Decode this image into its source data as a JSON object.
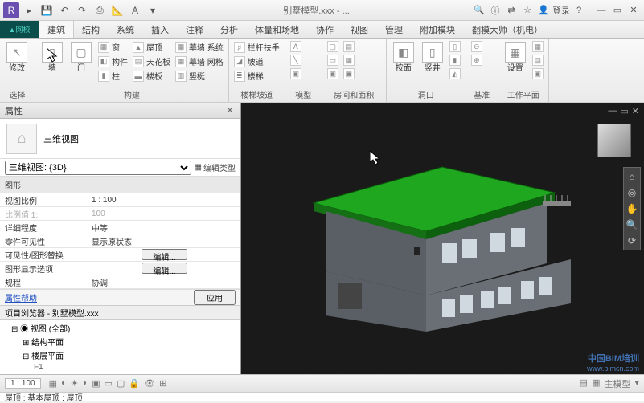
{
  "titlebar": {
    "doc_title": "别墅模型.xxx - ...",
    "login": "登录"
  },
  "ribbon_tabs": [
    "建筑",
    "结构",
    "系统",
    "插入",
    "注释",
    "分析",
    "体量和场地",
    "协作",
    "视图",
    "管理",
    "附加模块",
    "翻模大师（机电）"
  ],
  "active_tab": "建筑",
  "ribbon": {
    "select": {
      "label": "选择",
      "modify": "修改"
    },
    "build": {
      "label": "构建",
      "wall": "墙",
      "door": "门",
      "component": "构件",
      "column": "柱",
      "window": "窗",
      "roof": "屋顶",
      "ceiling": "天花板",
      "floor": "楼板",
      "curtain_system": "幕墙 系统",
      "curtain_grid": "幕墙 网格",
      "mullion": "竖梃"
    },
    "stair_ramp": {
      "label": "楼梯坡道",
      "railing": "栏杆扶手",
      "ramp": "坡道",
      "stair": "楼梯"
    },
    "model": {
      "label": "模型"
    },
    "room_area": {
      "label": "房间和面积"
    },
    "opening": {
      "label": "洞口",
      "by_face": "按面",
      "dormer": "竖井"
    },
    "datum": {
      "label": "基准"
    },
    "work_plane": {
      "label": "工作平面",
      "set": "设置"
    }
  },
  "props": {
    "title": "属性",
    "view_type": "三维视图",
    "selector": "三维视图: {3D}",
    "edit_type": "编辑类型",
    "group_graphics": "图形",
    "rows": [
      {
        "k": "视图比例",
        "v": "1 : 100"
      },
      {
        "k": "比例值 1:",
        "v": "100",
        "disabled": true
      },
      {
        "k": "详细程度",
        "v": "中等"
      },
      {
        "k": "零件可见性",
        "v": "显示原状态"
      },
      {
        "k": "可见性/图形替换",
        "btn": "编辑..."
      },
      {
        "k": "图形显示选项",
        "btn": "编辑..."
      },
      {
        "k": "规程",
        "v": "协调"
      }
    ],
    "help": "属性帮助",
    "apply": "应用"
  },
  "browser": {
    "title": "项目浏览器 - 别墅模型.xxx",
    "root": "视图 (全部)",
    "n1": "结构平面",
    "n2": "楼层平面",
    "n3": "F1"
  },
  "statusbar": {
    "scale": "1 : 100",
    "main_model": "主模型"
  },
  "infobar": {
    "left": "屋顶 : 基本屋顶 : 屋顶"
  },
  "watermark": {
    "l1": "中国BIM培训",
    "l2": "www.bimcn.com"
  }
}
